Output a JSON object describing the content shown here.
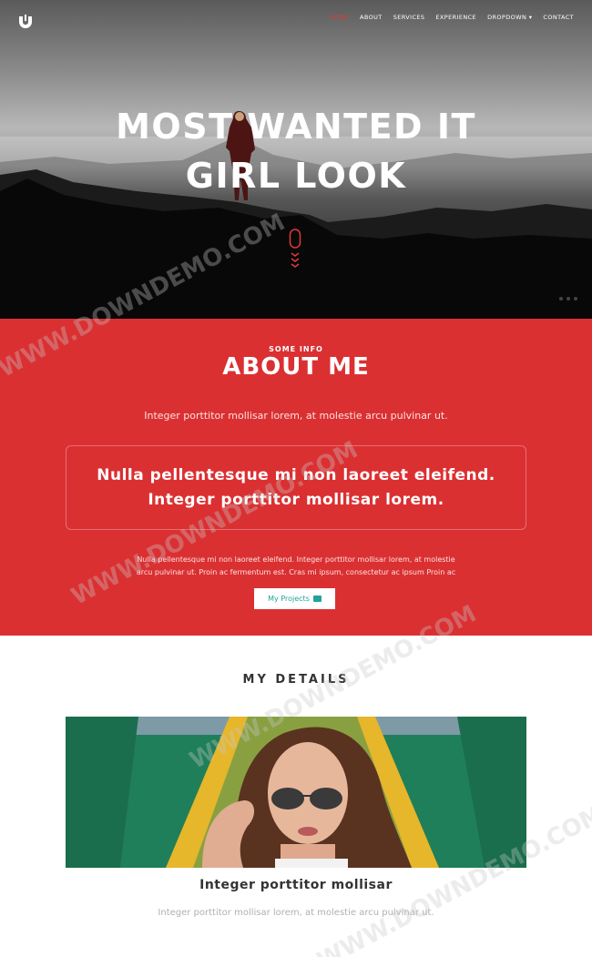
{
  "nav": {
    "items": [
      {
        "label": "Home",
        "active": true
      },
      {
        "label": "About"
      },
      {
        "label": "Services"
      },
      {
        "label": "Experience"
      },
      {
        "label": "Dropdown"
      },
      {
        "label": "Contact"
      }
    ]
  },
  "hero": {
    "title_line1": "MOST WANTED IT",
    "title_line2": "GIRL LOOK"
  },
  "about": {
    "kicker": "SOME INFO",
    "title": "ABOUT ME",
    "lead": "Integer porttitor mollisar lorem, at molestie arcu pulvinar ut.",
    "quote_line1": "Nulla pellentesque mi non laoreet eleifend.",
    "quote_line2": "Integer porttitor mollisar lorem.",
    "body_line1": "Nulla pellentesque mi non laoreet eleifend. Integer porttitor mollisar lorem, at molestie",
    "body_line2": "arcu pulvinar ut. Proin ac fermentum est. Cras mi ipsum, consectetur ac ipsum Proin ac",
    "button_label": "My Projects"
  },
  "details": {
    "title": "MY DETAILS",
    "card_title": "Integer porttitor mollisar",
    "card_text": "Integer porttitor mollisar lorem, at molestie arcu pulvinar ut."
  },
  "watermark": "WWW.DOWNDEMO.COM",
  "colors": {
    "accent": "#db3032",
    "button_text": "#22a39a"
  }
}
